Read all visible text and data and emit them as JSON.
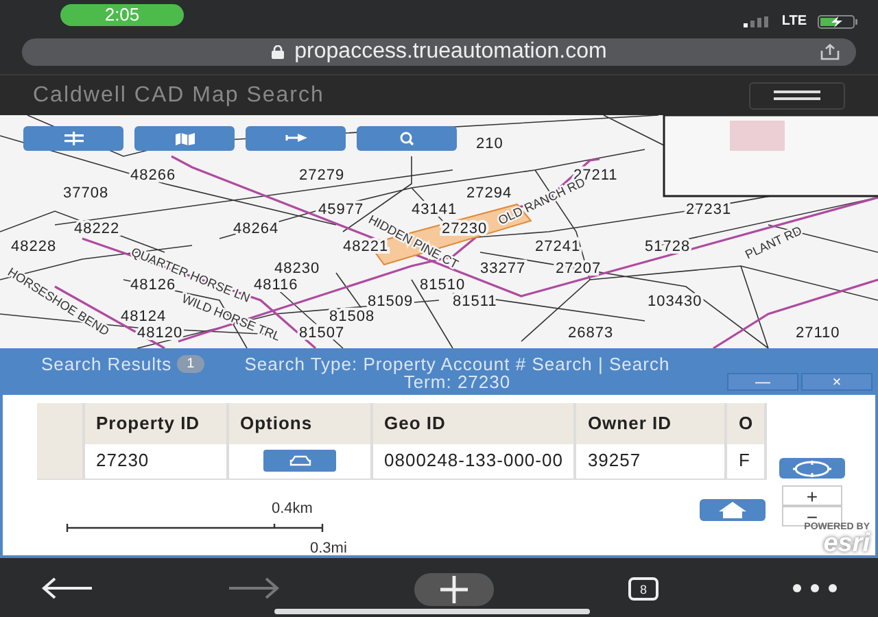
{
  "status_bar": {
    "time": "2:05",
    "network": "LTE"
  },
  "browser": {
    "url": "propaccess.trueautomation.com",
    "tab_count": "8",
    "forward_disabled": true
  },
  "app": {
    "title": "Caldwell CAD Map Search"
  },
  "map": {
    "parcels": [
      {
        "label": "210",
        "selected": false
      },
      {
        "label": "48266",
        "selected": false
      },
      {
        "label": "27279",
        "selected": false
      },
      {
        "label": "27211",
        "selected": false
      },
      {
        "label": "37708",
        "selected": false
      },
      {
        "label": "27294",
        "selected": false
      },
      {
        "label": "45977",
        "selected": false
      },
      {
        "label": "43141",
        "selected": false
      },
      {
        "label": "27231",
        "selected": false
      },
      {
        "label": "48222",
        "selected": false
      },
      {
        "label": "48264",
        "selected": false
      },
      {
        "label": "27230",
        "selected": true
      },
      {
        "label": "48228",
        "selected": false
      },
      {
        "label": "48221",
        "selected": false
      },
      {
        "label": "27241",
        "selected": false
      },
      {
        "label": "51728",
        "selected": false
      },
      {
        "label": "48230",
        "selected": false
      },
      {
        "label": "33277",
        "selected": false
      },
      {
        "label": "27207",
        "selected": false
      },
      {
        "label": "48126",
        "selected": false
      },
      {
        "label": "48116",
        "selected": false
      },
      {
        "label": "81510",
        "selected": false
      },
      {
        "label": "81509",
        "selected": false
      },
      {
        "label": "81511",
        "selected": false
      },
      {
        "label": "103430",
        "selected": false
      },
      {
        "label": "48124",
        "selected": false
      },
      {
        "label": "81508",
        "selected": false
      },
      {
        "label": "48120",
        "selected": false
      },
      {
        "label": "81507",
        "selected": false
      },
      {
        "label": "26873",
        "selected": false
      },
      {
        "label": "27110",
        "selected": false
      }
    ],
    "roads": [
      "OLD RANCH RD",
      "HIDDEN PINE CT",
      "QUARTER HORSE LN",
      "WILD HORSE TRL",
      "HORSESHOE BEND",
      "PLANT RD"
    ],
    "scale": {
      "metric": "0.4km",
      "imperial": "0.3mi"
    },
    "attribution": {
      "powered_by": "POWERED BY",
      "logo": "esri"
    },
    "zoom_in": "+",
    "zoom_out": "−"
  },
  "results": {
    "title": "Search Results",
    "count": "1",
    "summary": "Search Type: Property Account # Search | Search Term: 27230",
    "minimize": "—",
    "close": "×",
    "columns": [
      "Property ID",
      "Options",
      "Geo ID",
      "Owner ID",
      "O"
    ],
    "rows": [
      {
        "property_id": "27230",
        "geo_id": "0800248-133-000-00",
        "owner_id": "39257",
        "column_5": "F"
      }
    ]
  }
}
